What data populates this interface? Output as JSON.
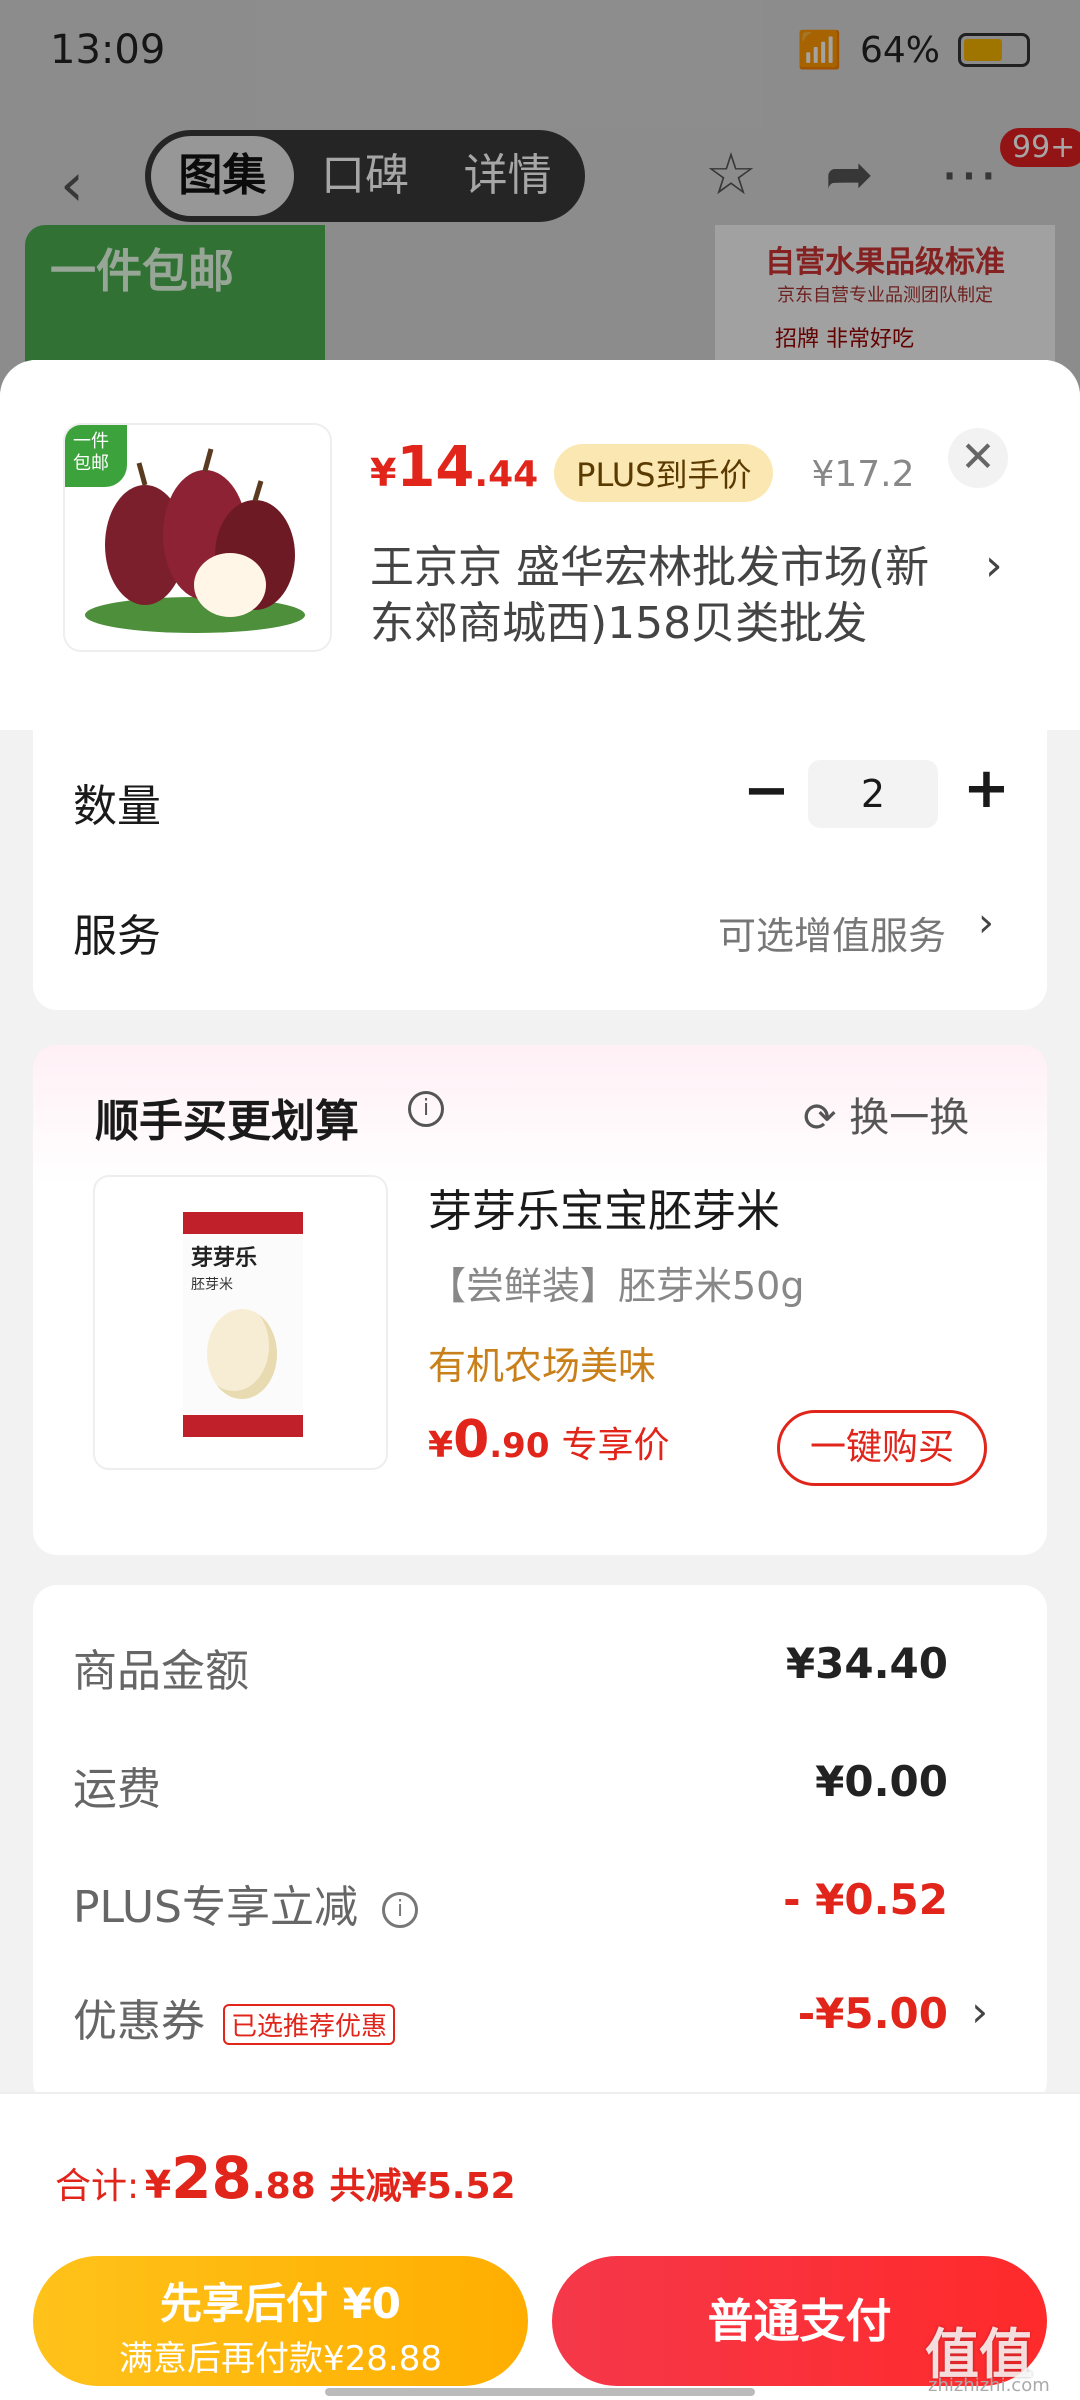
{
  "status": {
    "time": "13:09",
    "battery": "64%"
  },
  "nav": {
    "tabs": [
      "图集",
      "口碑",
      "详情"
    ],
    "badge": "99+"
  },
  "hero": {
    "left_text": "一件包邮",
    "right_title": "自营水果品级标准",
    "right_sub": "京东自营专业品测团队制定",
    "right_tag": "招牌 非常好吃"
  },
  "product": {
    "tag": "一件包邮",
    "price_symbol": "¥",
    "price_int": "14",
    "price_dec": ".44",
    "plus_label": "PLUS到手价",
    "orig_price": "¥17.2",
    "store": "王京京  盛华宏林批发市场(新东郊商城西)158贝类批发"
  },
  "quantity": {
    "label": "数量",
    "value": "2",
    "minus": "−",
    "plus": "+"
  },
  "service": {
    "label": "服务",
    "value": "可选增值服务"
  },
  "recommend": {
    "title": "顺手买更划算",
    "refresh": "换一换",
    "item": {
      "brand": "芽芽乐",
      "pack_sub": "胚芽米",
      "name": "芽芽乐宝宝胚芽米",
      "spec": "【尝鲜装】胚芽米50g",
      "slogan": "有机农场美味",
      "price_symbol": "¥",
      "price_int": "0",
      "price_dec": ".90",
      "price_label": "专享价",
      "buy": "一键购买"
    }
  },
  "summary": {
    "goods_label": "商品金额",
    "goods_value": "¥34.40",
    "ship_label": "运费",
    "ship_value": "¥0.00",
    "plus_label": "PLUS专享立减",
    "plus_value": "- ¥0.52",
    "coupon_label": "优惠券",
    "coupon_tag": "已选推荐优惠",
    "coupon_value": "-¥5.00"
  },
  "bottom": {
    "total_label": "合计:",
    "total_symbol": "¥",
    "total_int": "28",
    "total_dec": ".88",
    "total_save": "共减¥5.52",
    "later_l1": "先享后付 ¥0",
    "later_l2": "满意后再付款¥28.88",
    "pay": "普通支付"
  },
  "watermark": {
    "text": "值值值",
    "sub": "zhizhizhi.com"
  }
}
